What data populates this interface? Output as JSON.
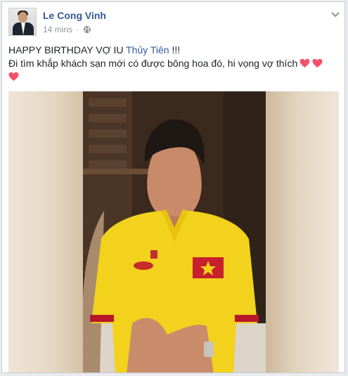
{
  "post": {
    "author": "Le Cong Vinh",
    "time": "14 mins",
    "separator": "·",
    "text_line1_prefix": "HAPPY BIRTHDAY VỢ IU ",
    "text_line1_tag": "Thủy Tiên",
    "text_line1_suffix": " !!!",
    "text_line2": "Đi tìm khắp khách sạn mới có được bông hoa đó, hi vọng vợ thích"
  },
  "icons": {
    "privacy": "globe-icon",
    "options": "chevron-down-icon",
    "emoji": "heart-icon"
  },
  "colors": {
    "link": "#365899",
    "meta": "#90949c",
    "heart": "#f25268",
    "jersey": "#f2d21c",
    "jersey_trim": "#b8172a"
  }
}
